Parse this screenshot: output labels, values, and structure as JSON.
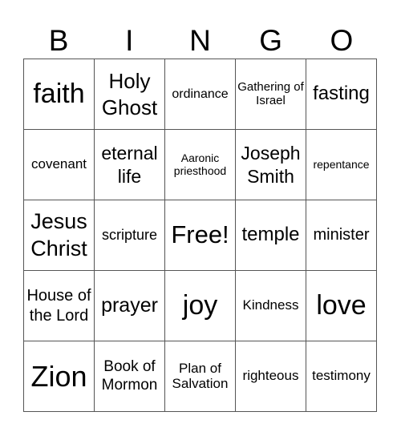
{
  "header": [
    "B",
    "I",
    "N",
    "G",
    "O"
  ],
  "cells": [
    [
      "faith",
      "Holy Ghost",
      "ordinance",
      "Gathering of Israel",
      "fasting"
    ],
    [
      "covenant",
      "eternal life",
      "Aaronic priesthood",
      "Joseph Smith",
      "repentance"
    ],
    [
      "Jesus Christ",
      "scripture",
      "Free!",
      "temple",
      "minister"
    ],
    [
      "House of the Lord",
      "prayer",
      "joy",
      "Kindness",
      "love"
    ],
    [
      "Zion",
      "Book of Mormon",
      "Plan of Salvation",
      "righteous",
      "testimony"
    ]
  ]
}
